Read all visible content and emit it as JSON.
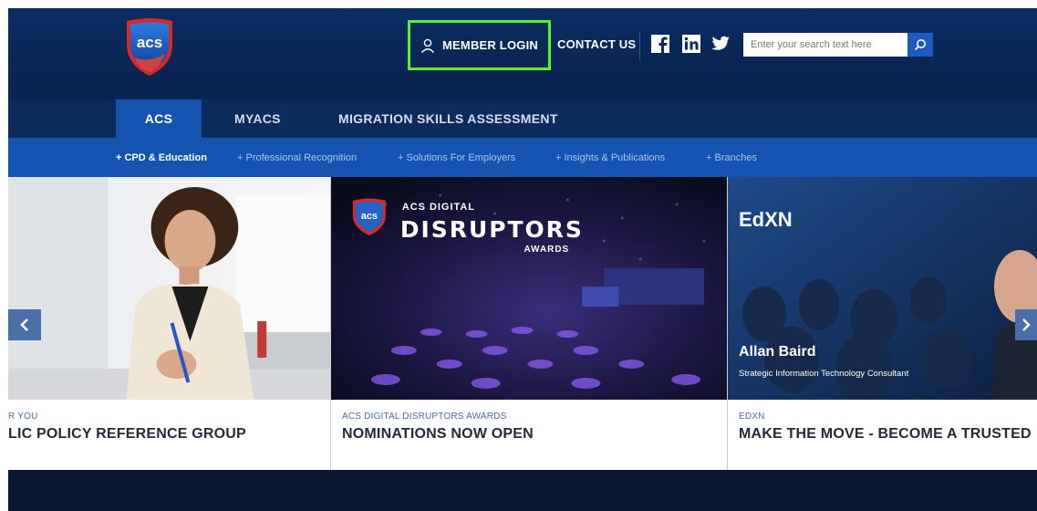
{
  "header": {
    "member_login": "MEMBER LOGIN",
    "contact_us": "CONTACT US",
    "search_placeholder": "Enter your search text here",
    "logo_text": "acs"
  },
  "main_nav": {
    "tabs": [
      {
        "label": "ACS",
        "active": true
      },
      {
        "label": "MYACS",
        "active": false
      },
      {
        "label": "MIGRATION SKILLS ASSESSMENT",
        "active": false
      }
    ]
  },
  "sub_nav": {
    "items": [
      {
        "label": "+ CPD & Education",
        "active": true
      },
      {
        "label": "+ Professional Recognition",
        "active": false
      },
      {
        "label": "+ Solutions For Employers",
        "active": false
      },
      {
        "label": "+ Insights & Publications",
        "active": false
      },
      {
        "label": "+ Branches",
        "active": false
      }
    ]
  },
  "cards": [
    {
      "category": "R YOU",
      "headline": "LIC POLICY REFERENCE GROUP"
    },
    {
      "category": "ACS DIGITAL DISRUPTORS AWARDS",
      "headline": "NOMINATIONS NOW OPEN",
      "banner_top": "ACS DIGITAL",
      "banner_main": "DISRUPTORS",
      "banner_sub": "AWARDS",
      "banner_logo": "acs"
    },
    {
      "category": "EDXN",
      "headline": "MAKE THE MOVE - BECOME A TRUSTED",
      "banner_title": "EdXN",
      "person_name": "Allan Baird",
      "person_role": "Strategic Information Technology Consultant"
    }
  ],
  "colors": {
    "highlight": "#5cf02f",
    "nav_active": "#1553b0",
    "header_bg": "#0a2d63"
  }
}
